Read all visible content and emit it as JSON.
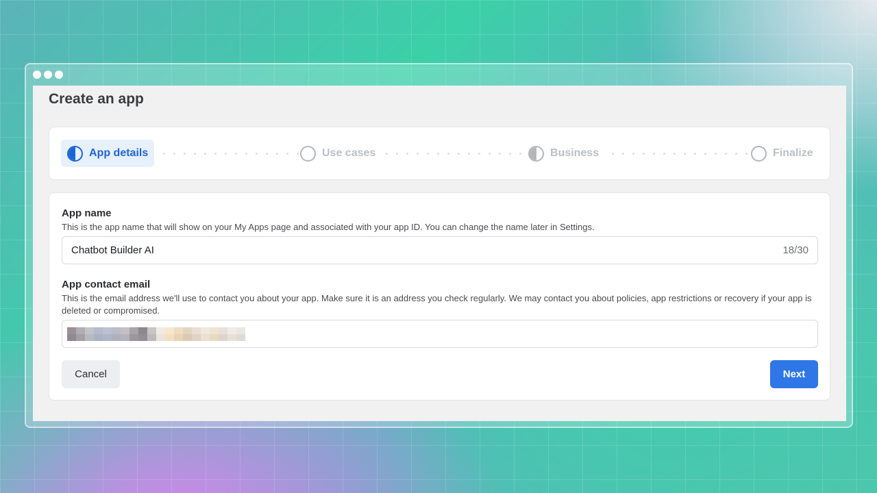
{
  "window": {
    "dots": 3
  },
  "page": {
    "title": "Create an app"
  },
  "stepper": {
    "steps": [
      {
        "label": "App details",
        "state": "active"
      },
      {
        "label": "Use cases",
        "state": "pending"
      },
      {
        "label": "Business",
        "state": "half"
      },
      {
        "label": "Finalize",
        "state": "pending"
      }
    ]
  },
  "form": {
    "app_name": {
      "label": "App name",
      "description": "This is the app name that will show on your My Apps page and associated with your app ID. You can change the name later in Settings.",
      "value": "Chatbot Builder AI",
      "counter": "18/30"
    },
    "contact_email": {
      "label": "App contact email",
      "description": "This is the email address we'll use to contact you about your app. Make sure it is an address you check regularly. We may contact you about policies, app restrictions or recovery if your app is deleted or compromised.",
      "value_redacted": true
    },
    "cancel_label": "Cancel",
    "next_label": "Next"
  },
  "colors": {
    "accent": "#2f76e6",
    "active_step_bg": "#e7f0fd",
    "active_step_text": "#1b66d6"
  }
}
